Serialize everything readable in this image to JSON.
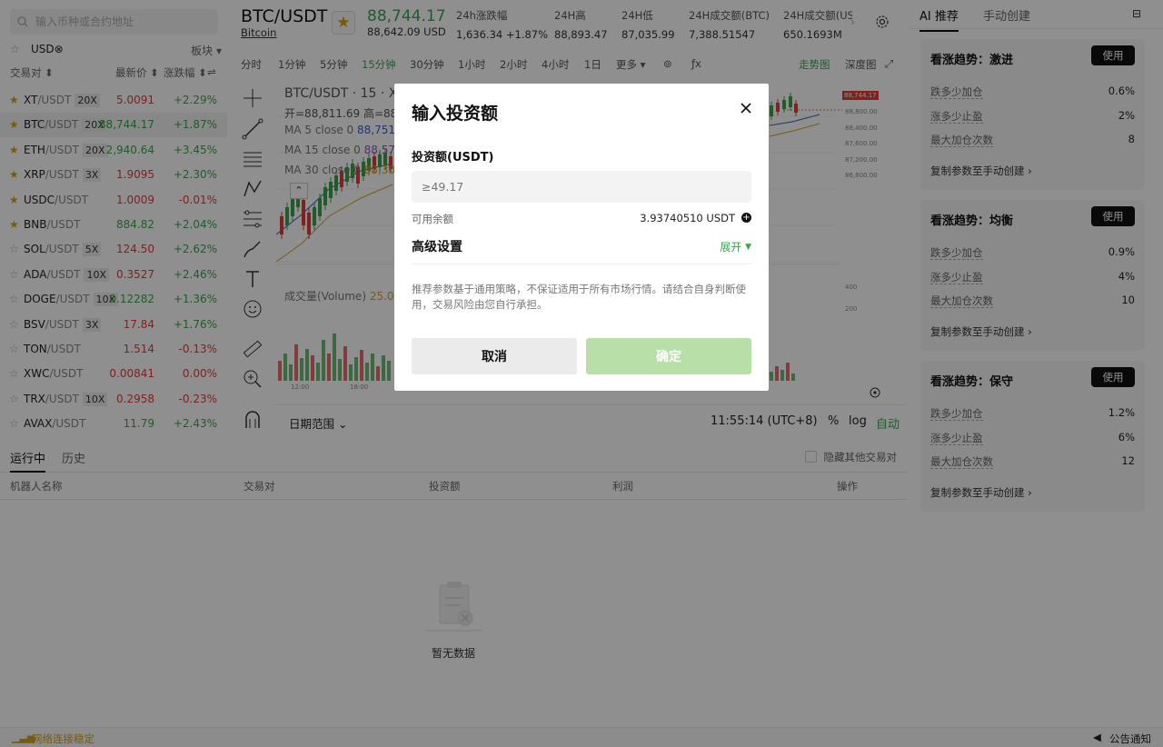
{
  "sidebar": {
    "search_placeholder": "输入币种或合约地址",
    "filter_currency": "USD⊗",
    "filter_sector": "板块 ▾",
    "col_pair": "交易对 ⬍",
    "col_price": "最新价 ⬍",
    "col_change": "涨跌幅 ⬍",
    "rows": [
      {
        "base": "XT",
        "quote": "/USDT",
        "lev": "20X",
        "price": "5.0091",
        "change": "+2.29%",
        "dir": "down",
        "fav": true
      },
      {
        "base": "BTC",
        "quote": "/USDT",
        "lev": "20X",
        "price": "88,744.17",
        "change": "+1.87%",
        "dir": "up",
        "fav": true
      },
      {
        "base": "ETH",
        "quote": "/USDT",
        "lev": "20X",
        "price": "2,940.64",
        "change": "+3.45%",
        "dir": "up",
        "fav": true
      },
      {
        "base": "XRP",
        "quote": "/USDT",
        "lev": "3X",
        "price": "1.9095",
        "change": "+2.30%",
        "dir": "down",
        "fav": true
      },
      {
        "base": "USDC",
        "quote": "/USDT",
        "lev": "",
        "price": "1.0009",
        "change": "-0.01%",
        "dir": "down",
        "fav": true
      },
      {
        "base": "BNB",
        "quote": "/USDT",
        "lev": "",
        "price": "884.82",
        "change": "+2.04%",
        "dir": "up",
        "fav": true
      },
      {
        "base": "SOL",
        "quote": "/USDT",
        "lev": "5X",
        "price": "124.50",
        "change": "+2.62%",
        "dir": "down",
        "fav": false
      },
      {
        "base": "ADA",
        "quote": "/USDT",
        "lev": "10X",
        "price": "0.3527",
        "change": "+2.46%",
        "dir": "down",
        "fav": false
      },
      {
        "base": "DOGE",
        "quote": "/USDT",
        "lev": "10X",
        "price": "0.12282",
        "change": "+1.36%",
        "dir": "up",
        "fav": false
      },
      {
        "base": "BSV",
        "quote": "/USDT",
        "lev": "3X",
        "price": "17.84",
        "change": "+1.76%",
        "dir": "down",
        "fav": false
      },
      {
        "base": "TON",
        "quote": "/USDT",
        "lev": "",
        "price": "1.514",
        "change": "-0.13%",
        "dir": "down",
        "fav": false
      },
      {
        "base": "XWC",
        "quote": "/USDT",
        "lev": "",
        "price": "0.00841",
        "change": "0.00%",
        "dir": "down",
        "fav": false
      },
      {
        "base": "TRX",
        "quote": "/USDT",
        "lev": "10X",
        "price": "0.2958",
        "change": "-0.23%",
        "dir": "down",
        "fav": false
      },
      {
        "base": "AVAX",
        "quote": "/USDT",
        "lev": "",
        "price": "11.79",
        "change": "+2.43%",
        "dir": "up",
        "fav": false
      }
    ]
  },
  "header": {
    "symbol": "BTC/USDT",
    "symbol_sub": "Bitcoin",
    "last_price": "88,744.17",
    "last_price_usd": "88,642.09 USD",
    "stats": [
      {
        "k": "24h涨跌幅",
        "v": "1,636.34 +1.87%"
      },
      {
        "k": "24H高",
        "v": "88,893.47"
      },
      {
        "k": "24H低",
        "v": "87,035.99"
      },
      {
        "k": "24H成交额(BTC)",
        "v": "7,388.51547"
      },
      {
        "k": "24H成交额(USDT)",
        "v": "650.1693M"
      }
    ]
  },
  "toolbar": {
    "timeframes": [
      "分时",
      "1分钟",
      "5分钟",
      "15分钟",
      "30分钟",
      "1小时",
      "2小时",
      "4小时",
      "1日",
      "更多 ▾"
    ],
    "selected": "15分钟",
    "trend": "走势图",
    "depth": "深度图"
  },
  "chart": {
    "title": "BTC/USDT · 15 · X",
    "ohlc": "开=88,811.69  高=88,",
    "ma5": "MA 5 close 0",
    "ma5_val": "88,751",
    "ma15": "MA 15 close 0",
    "ma15_val": "88,57",
    "ma30": "MA 30 close 0",
    "ma30_val": "88,30",
    "volume": "成交量(Volume)",
    "volume_val": "25.04",
    "price_tag": "88,744.17",
    "axis_prices": [
      "88,800.00",
      "88,400.00",
      "87,600.00",
      "87,200.00",
      "86,800.00"
    ],
    "vol_axis": [
      "400",
      "200"
    ],
    "time_labels": [
      "12:00",
      "18:00"
    ],
    "date_range": "日期范围 ⌄",
    "time": "11:55:14 (UTC+8)",
    "percent": "%",
    "log": "log",
    "auto": "自动"
  },
  "bottom": {
    "tab_running": "运行中",
    "tab_history": "历史",
    "hide_other": "隐藏其他交易对",
    "columns": [
      "机器人名称",
      "交易对",
      "投资额",
      "利润",
      "操作"
    ],
    "empty_text": "暂无数据"
  },
  "footer": {
    "status": "网络连接稳定",
    "notice": "公告通知"
  },
  "ai_panel": {
    "tab_ai": "AI 推荐",
    "tab_manual": "手动创建",
    "use_label": "使用",
    "copy_label": "复制参数至手动创建 ›",
    "cards": [
      {
        "title": "看涨趋势：激进",
        "rows": [
          {
            "k": "跌多少加仓",
            "v": "0.6%"
          },
          {
            "k": "涨多少止盈",
            "v": "2%"
          },
          {
            "k": "最大加仓次数",
            "v": "8"
          }
        ]
      },
      {
        "title": "看涨趋势：均衡",
        "rows": [
          {
            "k": "跌多少加仓",
            "v": "0.9%"
          },
          {
            "k": "涨多少止盈",
            "v": "4%"
          },
          {
            "k": "最大加仓次数",
            "v": "10"
          }
        ]
      },
      {
        "title": "看涨趋势：保守",
        "rows": [
          {
            "k": "跌多少加仓",
            "v": "1.2%"
          },
          {
            "k": "涨多少止盈",
            "v": "6%"
          },
          {
            "k": "最大加仓次数",
            "v": "12"
          }
        ]
      }
    ]
  },
  "modal": {
    "title": "输入投资额",
    "label": "投资额(USDT)",
    "placeholder": "≥49.17",
    "balance_label": "可用余额",
    "balance_value": "3.93740510 USDT",
    "advanced": "高级设置",
    "expand": "展开",
    "note": "推荐参数基于通用策略，不保证适用于所有市场行情。请结合自身判断使用，交易风险由您自行承担。",
    "cancel": "取消",
    "confirm": "确定"
  }
}
